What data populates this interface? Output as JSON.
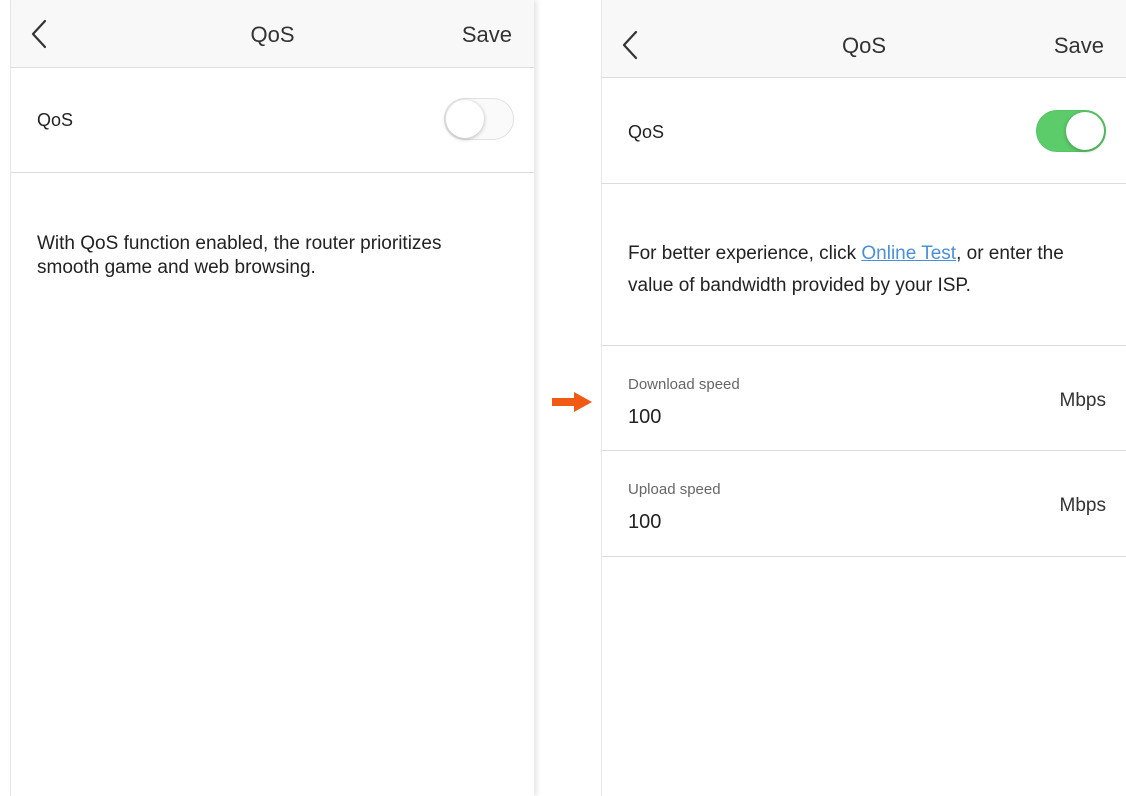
{
  "left_screen": {
    "title": "QoS",
    "save_label": "Save",
    "qos_label": "QoS",
    "qos_enabled": false,
    "description": "With QoS function enabled, the router prioritizes smooth game and web browsing."
  },
  "right_screen": {
    "title": "QoS",
    "save_label": "Save",
    "qos_label": "QoS",
    "qos_enabled": true,
    "description_prefix": "For better experience, click ",
    "online_test_link": "Online Test",
    "description_suffix": ", or enter the value of bandwidth provided by your ISP.",
    "download": {
      "label": "Download speed",
      "value": "100",
      "unit": "Mbps"
    },
    "upload": {
      "label": "Upload speed",
      "value": "100",
      "unit": "Mbps"
    }
  },
  "colors": {
    "toggle_on": "#5ccc6a",
    "link": "#4a90d6",
    "arrow": "#f05a14"
  },
  "icons": {
    "back": "chevron-left-icon",
    "flow_arrow": "arrow-right-icon"
  }
}
